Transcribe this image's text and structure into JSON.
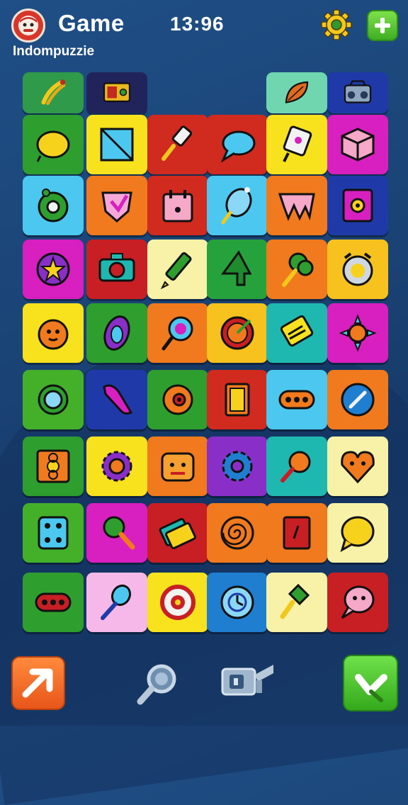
{
  "header": {
    "title": "Game",
    "clock": "13:96",
    "subtitle": "Indompuzzie"
  },
  "colors": {
    "background": "#1a4274",
    "accent_green": "#4cc02c",
    "accent_orange": "#f06a1e",
    "gear": "#f2c81c"
  },
  "board": {
    "top_row": [
      {
        "col": 0,
        "color": "#2e9a4a",
        "icon": "bananas-icon"
      },
      {
        "col": 1,
        "color": "#21245a",
        "icon": "radio-icon"
      },
      {
        "col": 4,
        "color": "#6fd6b0",
        "icon": "leaf-icon"
      },
      {
        "col": 5,
        "color": "#1f3aa8",
        "icon": "boombox-icon"
      }
    ],
    "rows": [
      [
        {
          "color": "#2e9e2e",
          "icon": "lemon-icon"
        },
        {
          "color": "#f7e21d",
          "icon": "frame-icon"
        },
        {
          "color": "#d12a1f",
          "icon": "paint-roller-icon"
        },
        {
          "color": "#d12a1f",
          "icon": "speech-bubble-icon"
        },
        {
          "color": "#f7e21d",
          "icon": "tag-icon"
        },
        {
          "color": "#d81fbf",
          "icon": "cube-icon"
        }
      ],
      [
        {
          "color": "#4cc8f0",
          "icon": "donut-icon"
        },
        {
          "color": "#f07a1d",
          "icon": "heart-shield-icon"
        },
        {
          "color": "#d12a1f",
          "icon": "calendar-icon"
        },
        {
          "color": "#4cc8f0",
          "icon": "ice-cream-icon"
        },
        {
          "color": "#f07a1d",
          "icon": "crown-icon"
        },
        {
          "color": "#1f3aa8",
          "icon": "speaker-icon"
        }
      ],
      [
        {
          "color": "#d81fbf",
          "icon": "star-icon"
        },
        {
          "color": "#c81f24",
          "icon": "camera-icon"
        },
        {
          "color": "#f8f2a8",
          "icon": "pencil-icon"
        },
        {
          "color": "#26a23c",
          "icon": "four-icon"
        },
        {
          "color": "#f07a1d",
          "icon": "broccoli-icon"
        },
        {
          "color": "#f7c21d",
          "icon": "alarm-icon"
        }
      ],
      [
        {
          "color": "#f7e21d",
          "icon": "orange-face-icon"
        },
        {
          "color": "#2e9e2e",
          "icon": "avocado-icon"
        },
        {
          "color": "#f07a1d",
          "icon": "lollipop-icon"
        },
        {
          "color": "#f7c21d",
          "icon": "target-icon"
        },
        {
          "color": "#1fb8b0",
          "icon": "notes-icon"
        },
        {
          "color": "#d81fbf",
          "icon": "sun-icon"
        }
      ],
      [
        {
          "color": "#44b02a",
          "icon": "watch-icon"
        },
        {
          "color": "#1f3aa8",
          "icon": "feather-icon"
        },
        {
          "color": "#2e9e2e",
          "icon": "eye-icon"
        },
        {
          "color": "#d12a1f",
          "icon": "door-icon"
        },
        {
          "color": "#4cc8f0",
          "icon": "pill-icon"
        },
        {
          "color": "#f07a1d",
          "icon": "compass-icon"
        }
      ],
      [
        {
          "color": "#2e9e2e",
          "icon": "flower-box-icon"
        },
        {
          "color": "#f7e21d",
          "icon": "gear-flower-icon"
        },
        {
          "color": "#f07a1d",
          "icon": "robot-face-icon"
        },
        {
          "color": "#8a2ec8",
          "icon": "cog-icon"
        },
        {
          "color": "#1fb8b0",
          "icon": "racket-icon"
        },
        {
          "color": "#f8f2a8",
          "icon": "heart-icon"
        }
      ],
      [
        {
          "color": "#44b02a",
          "icon": "dice-icon"
        },
        {
          "color": "#d81fbf",
          "icon": "magnifier-icon"
        },
        {
          "color": "#c81f24",
          "icon": "tickets-icon"
        },
        {
          "color": "#f07a1d",
          "icon": "spiral-icon"
        },
        {
          "color": "#f07a1d",
          "icon": "book-icon"
        },
        {
          "color": "#f8f2a8",
          "icon": "chat-icon"
        }
      ],
      [
        {
          "color": "#2e9e2e",
          "icon": "traffic-light-icon"
        },
        {
          "color": "#f5b8e8",
          "icon": "spoon-icon"
        },
        {
          "color": "#f7e21d",
          "icon": "badge-icon"
        },
        {
          "color": "#1f7ed0",
          "icon": "clock-icon"
        },
        {
          "color": "#f8f2a8",
          "icon": "brush-icon"
        },
        {
          "color": "#c81f24",
          "icon": "thought-icon"
        }
      ]
    ]
  },
  "toolbar": {
    "left": {
      "icon": "arrow-icon",
      "color": "#f06a1e"
    },
    "center_left": {
      "icon": "magnifier-tool-icon"
    },
    "center_right": {
      "icon": "projector-icon"
    },
    "right": {
      "icon": "check-icon",
      "color": "#4cc02c"
    }
  }
}
